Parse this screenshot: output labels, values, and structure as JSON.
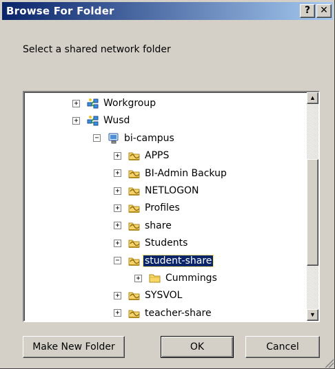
{
  "window": {
    "title": "Browse For Folder",
    "help_label": "?",
    "close_label": "✕"
  },
  "instruction": "Select a shared network folder",
  "tree": {
    "items": [
      {
        "label": "Workgroup",
        "icon": "network-group-icon",
        "expander": "+"
      },
      {
        "label": "Wusd",
        "icon": "network-group-icon",
        "expander": "+"
      },
      {
        "label": "bi-campus",
        "icon": "computer-icon",
        "expander": "−"
      },
      {
        "label": "APPS",
        "icon": "shared-folder-icon",
        "expander": "+"
      },
      {
        "label": "BI-Admin Backup",
        "icon": "shared-folder-icon",
        "expander": "+"
      },
      {
        "label": "NETLOGON",
        "icon": "shared-folder-icon",
        "expander": "+"
      },
      {
        "label": "Profiles",
        "icon": "shared-folder-icon",
        "expander": "+"
      },
      {
        "label": "share",
        "icon": "shared-folder-icon",
        "expander": "+"
      },
      {
        "label": "Students",
        "icon": "shared-folder-icon",
        "expander": "+"
      },
      {
        "label": "student-share",
        "icon": "shared-folder-icon",
        "expander": "−",
        "selected": true
      },
      {
        "label": "Cummings",
        "icon": "folder-icon",
        "expander": "+"
      },
      {
        "label": "SYSVOL",
        "icon": "shared-folder-icon",
        "expander": "+"
      },
      {
        "label": "teacher-share",
        "icon": "shared-folder-icon",
        "expander": "+"
      }
    ]
  },
  "scrollbar": {
    "up": "▲",
    "down": "▼"
  },
  "buttons": {
    "new_folder": "Make New Folder",
    "ok": "OK",
    "cancel": "Cancel"
  },
  "colors": {
    "title_start": "#0a246a",
    "title_end": "#a6caf0",
    "dialog_face": "#d4d0c8",
    "selection": "#0a246a"
  }
}
